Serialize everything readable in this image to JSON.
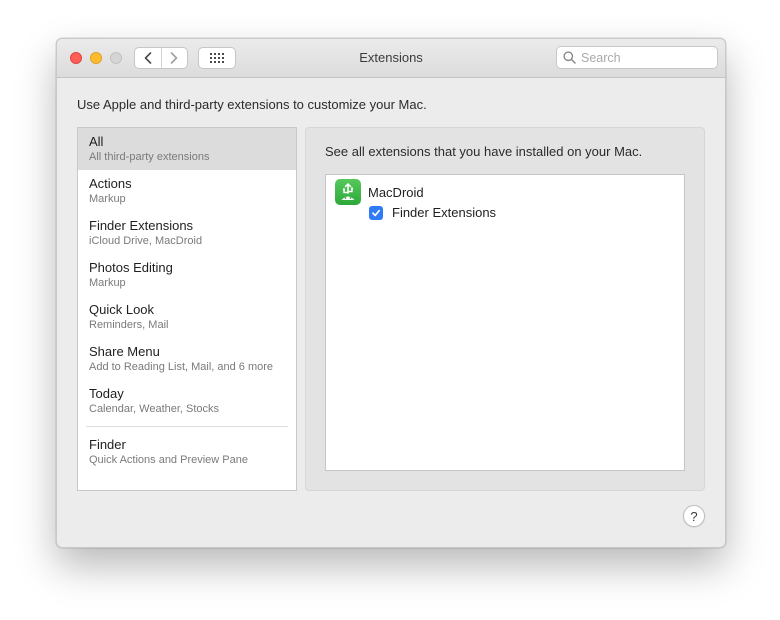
{
  "window": {
    "title": "Extensions"
  },
  "toolbar": {
    "search_placeholder": "Search"
  },
  "intro_text": "Use Apple and third-party extensions to customize your Mac.",
  "sidebar": {
    "items": [
      {
        "title": "All",
        "subtitle": "All third-party extensions",
        "selected": true
      },
      {
        "title": "Actions",
        "subtitle": "Markup"
      },
      {
        "title": "Finder Extensions",
        "subtitle": "iCloud Drive, MacDroid"
      },
      {
        "title": "Photos Editing",
        "subtitle": "Markup"
      },
      {
        "title": "Quick Look",
        "subtitle": "Reminders, Mail"
      },
      {
        "title": "Share Menu",
        "subtitle": "Add to Reading List, Mail, and 6 more"
      },
      {
        "title": "Today",
        "subtitle": "Calendar, Weather, Stocks"
      },
      {
        "title": "Finder",
        "subtitle": "Quick Actions and Preview Pane"
      }
    ]
  },
  "content": {
    "heading": "See all extensions that you have installed on your Mac.",
    "apps": [
      {
        "name": "MacDroid",
        "icon": "macdroid-app-icon",
        "extensions": [
          {
            "name": "Finder Extensions",
            "enabled": true
          }
        ]
      }
    ]
  },
  "help_label": "?",
  "colors": {
    "close": "#fe5f57",
    "minimize": "#febc2e",
    "zoom": "#d5d5d5",
    "checkbox_accent": "#2f7cf6",
    "app_icon": "#3bb548",
    "selected_row": "#dcdcdc"
  }
}
